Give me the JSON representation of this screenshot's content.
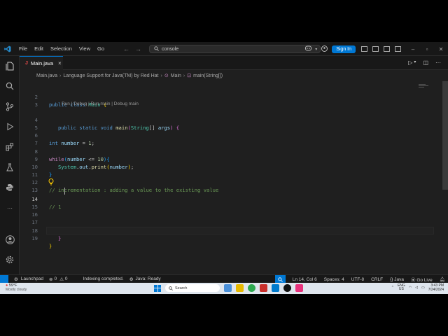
{
  "titlebar": {
    "menu": [
      "File",
      "Edit",
      "Selection",
      "View",
      "Go"
    ],
    "search_text": "console",
    "signin_label": "Sign In"
  },
  "tab": {
    "name": "Main.java",
    "icon_letter": "J"
  },
  "breadcrumb": {
    "file": "Main.java",
    "extension": "Language Support for Java(TM) by Red Hat",
    "class": "Main",
    "method": "main(String[])"
  },
  "editor": {
    "code_lens": "Run | Debug | Run main | Debug main",
    "line_numbers": [
      "2",
      "3",
      "4",
      "5",
      "6",
      "7",
      "8",
      "9",
      "10",
      "11",
      "12",
      "13",
      "14",
      "15",
      "16",
      "17",
      "18",
      "19"
    ],
    "current_line": "14",
    "cursor": "Ln 14, Col 6"
  },
  "statusbar": {
    "launchpad": "Launchpad",
    "errors": "0",
    "warnings": "0",
    "indexing": "Indexing completed.",
    "java_status": "Java: Ready",
    "position": "Ln 14, Col 6",
    "spaces": "Spaces: 4",
    "encoding": "UTF-8",
    "eol": "CRLF",
    "language": "Java",
    "golive": "Go Live"
  },
  "taskbar": {
    "temperature": "59°F",
    "condition": "Mostly cloudy",
    "search_label": "Search",
    "lang_top": "ENG",
    "lang_bottom": "US",
    "time": "3:43 PM",
    "date": "7/24/2024"
  },
  "colors": {
    "accent": "#0078d4",
    "editor_bg": "#1f1f1f",
    "keyword": "#569cd6",
    "type": "#4ec9b0",
    "comment": "#6a9955"
  }
}
